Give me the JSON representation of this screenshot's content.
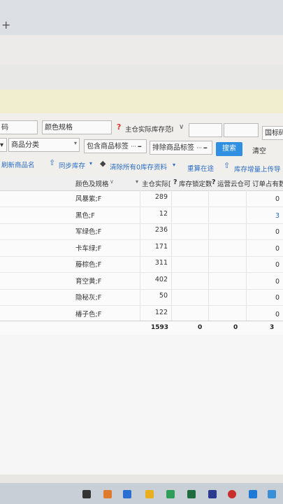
{
  "browser": {
    "new_tab_symbol": "+"
  },
  "filters": {
    "code_suffix": "码",
    "color_spec_label": "颜色规格",
    "warehouse_stock_range_label": "主仓实际库存范I",
    "barcode_label": "国标码",
    "product_category_label": "商品分类",
    "include_tag_label": "包含商品标签",
    "exclude_tag_label": "排除商品标签",
    "dots": "··· ━",
    "search_label": "搜索",
    "clear_label": "清空"
  },
  "actions": {
    "refresh_name": "刷新商品名",
    "sync_stock": "同步库存",
    "clear_zero_stock": "清除所有0库存资料",
    "recalc_in_transit": "重算在途",
    "upload_stock_increment": "库存增量上传导"
  },
  "table": {
    "headers": {
      "color_spec": "颜色及规格",
      "main_warehouse_actual": "主仓实际[",
      "stock_locked": "库存锁定数",
      "cloud_warehouse_available": "运营云仓可",
      "order_occupied": "订单占有数"
    },
    "rows": [
      {
        "name": "风暴紫;F",
        "qty": "289",
        "last": "0"
      },
      {
        "name": "黑色;F",
        "qty": "12",
        "last": "3"
      },
      {
        "name": "军绿色;F",
        "qty": "236",
        "last": "0"
      },
      {
        "name": "卡车绿;F",
        "qty": "171",
        "last": "0"
      },
      {
        "name": "藤棕色;F",
        "qty": "311",
        "last": "0"
      },
      {
        "name": "育空黄;F",
        "qty": "402",
        "last": "0"
      },
      {
        "name": "隐秘灰;F",
        "qty": "50",
        "last": "0"
      },
      {
        "name": "椿子色;F",
        "qty": "122",
        "last": "0"
      }
    ],
    "totals": {
      "main": "1593",
      "locked": "0",
      "cloud": "0",
      "occupied": "3"
    }
  },
  "colors": {
    "accent": "#2f8fe0",
    "link": "#2b6cc4",
    "warning": "#d9342b"
  }
}
